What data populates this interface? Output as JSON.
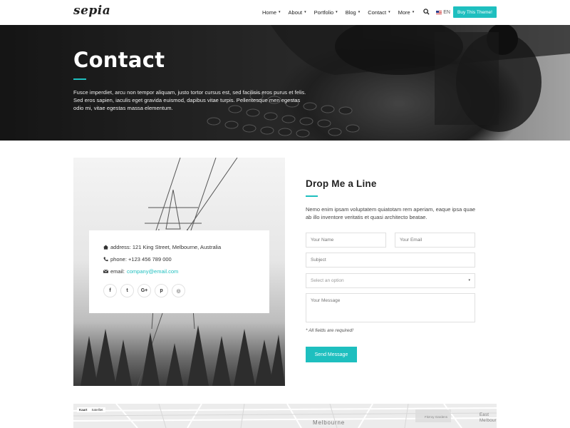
{
  "brand": {
    "logo_text": "sepia"
  },
  "nav": {
    "items": [
      {
        "label": "Home",
        "caret": "▾"
      },
      {
        "label": "About",
        "caret": "▾"
      },
      {
        "label": "Portfolio",
        "caret": "▾"
      },
      {
        "label": "Blog",
        "caret": "▾"
      },
      {
        "label": "Contact",
        "caret": "▾"
      },
      {
        "label": "More",
        "caret": "▾"
      }
    ],
    "search_icon": "search-icon",
    "language": "EN",
    "cta_label": "Buy This Theme!"
  },
  "hero": {
    "title": "Contact",
    "text": "Fusce imperdiet, arcu non tempor aliquam, justo tortor cursus est, sed facilisis eros purus et felis. Sed eros sapien, iaculis eget gravida euismod, dapibus vitae turpis. Pellentesque men egestas odio mi, vitae egestas massa elementum."
  },
  "contact_info": {
    "address_label": "address:",
    "address": "121 King Street, Melbourne, Australia",
    "phone_label": "phone:",
    "phone": "+123 456 789 000",
    "email_label": "email:",
    "email": "company@email.com",
    "socials": [
      {
        "icon": "facebook-icon",
        "glyph": "f"
      },
      {
        "icon": "twitter-icon",
        "glyph": "t"
      },
      {
        "icon": "google-plus-icon",
        "glyph": "G+"
      },
      {
        "icon": "pinterest-icon",
        "glyph": "p"
      },
      {
        "icon": "dribbble-icon",
        "glyph": "◎"
      }
    ]
  },
  "form": {
    "title": "Drop Me a Line",
    "intro": "Nemo enim ipsam voluptatem quiatotam rem aperiam, eaque ipsa quae ab illo inventore veritatis et quasi architecto beatae.",
    "name_placeholder": "Your Name",
    "email_placeholder": "Your Email",
    "subject_placeholder": "Subject",
    "select_value": "Select an option",
    "message_placeholder": "Your Message",
    "required_note": "* All fields are required!",
    "submit_label": "Send Message"
  },
  "map": {
    "tabs": [
      "Kaart",
      "Satelliet"
    ],
    "city_label": "Melbourne",
    "east_label": "East Melbourne",
    "area_label": "Fitzroy Gardens"
  },
  "colors": {
    "accent": "#1ebfbf"
  }
}
